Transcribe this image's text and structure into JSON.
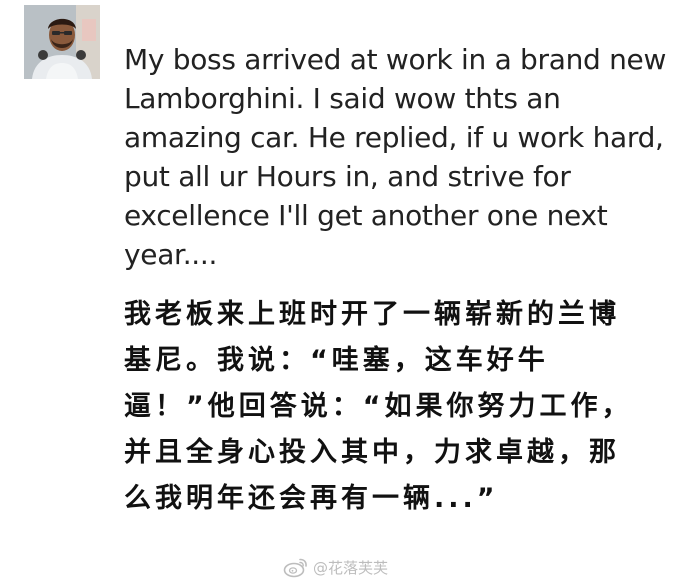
{
  "post": {
    "avatar_icon": "user-avatar-photo",
    "text": "My boss arrived at work in a brand new Lamborghini. I said wow thts an amazing car. He replied, if u work hard, put all ur Hours in, and strive for excellence I'll get another one next year....",
    "translation": "我老板来上班时开了一辆崭新的兰博基尼。我说：“哇塞，这车好牛逼！”他回答说：“如果你努力工作，并且全身心投入其中，力求卓越，那么我明年还会再有一辆...”"
  },
  "watermark": {
    "icon": "weibo-logo-icon",
    "text": "@花落芙芙"
  },
  "colors": {
    "text": "#222222",
    "translation": "#111111",
    "watermark": "#bdbdbd"
  }
}
